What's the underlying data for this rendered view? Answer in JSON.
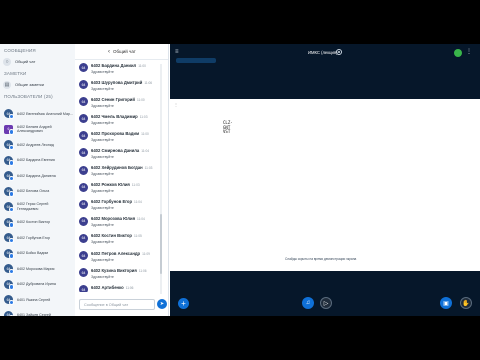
{
  "userlist": {
    "messages_title": "Сообщения",
    "public_chat": "Общий чат",
    "notes_title": "Заметки",
    "shared_notes": "Общие заметки",
    "users_title": "Пользователи (25)",
    "users": [
      {
        "initials": "64",
        "name": "6402 Евгенийчик Анатолий Мар..."
      },
      {
        "initials": "6",
        "name": "6402 Беляев Андрей\nАлександрович"
      },
      {
        "initials": "64",
        "name": "6402 Андреев Леонид"
      },
      {
        "initials": "64",
        "name": "6402 Бардина Евгения"
      },
      {
        "initials": "64",
        "name": "6402 Бардина Даниела"
      },
      {
        "initials": "64",
        "name": "6402 Белова Ольга"
      },
      {
        "initials": "64",
        "name": "6402 Герас Сергей\nГеннадьевич"
      },
      {
        "initials": "64",
        "name": "6402 Костин Виктор"
      },
      {
        "initials": "64",
        "name": "6402 Горбунов Егор"
      },
      {
        "initials": "64",
        "name": "6402 Бойко Вадим"
      },
      {
        "initials": "64",
        "name": "6402 Морозова Мария"
      },
      {
        "initials": "64",
        "name": "6402 Дубровина Ирина"
      },
      {
        "initials": "64",
        "name": "6401 Яшина Сергей"
      },
      {
        "initials": "64",
        "name": "6401 Зайцев Сергей"
      }
    ]
  },
  "chat": {
    "title": "Общий чат",
    "input_placeholder": "Сообщение в Общий чат",
    "messages": [
      {
        "initials": "64",
        "name": "6402 Бардина Даниил",
        "time": "11:00",
        "text": "Здравствуйте"
      },
      {
        "initials": "64",
        "name": "6403 Шурупова Дмитрий",
        "time": "11:06",
        "text": "Здравствуйте"
      },
      {
        "initials": "64",
        "name": "6402 Сенин Григорий",
        "time": "11:00",
        "text": "Здравствуйте"
      },
      {
        "initials": "64",
        "name": "6402 Чмель Владимир",
        "time": "11:03",
        "text": "Здравствуйте"
      },
      {
        "initials": "64",
        "name": "6402 Прохорова Вадим",
        "time": "11:00",
        "text": "Здравствуйте"
      },
      {
        "initials": "64",
        "name": "6402 Смирнова Данила",
        "time": "11:04",
        "text": "Здравствуйте"
      },
      {
        "initials": "64",
        "name": "6402 Хейрудинов Богдан",
        "time": "11:03",
        "text": "Здравствуйте"
      },
      {
        "initials": "64",
        "name": "6402 Рожков Юлия",
        "time": "11:03",
        "text": "Здравствуйте"
      },
      {
        "initials": "64",
        "name": "6402 Горбунов Егор",
        "time": "11:04",
        "text": "Здравствуйте"
      },
      {
        "initials": "64",
        "name": "6402 Морозова Юлия",
        "time": "11:04",
        "text": "Здравствуйте"
      },
      {
        "initials": "64",
        "name": "6402 Костин Виктор",
        "time": "11:05",
        "text": "Здравствуйте"
      },
      {
        "initials": "64",
        "name": "6402 Петров Александр",
        "time": "11:09",
        "text": "Здравствуйте"
      },
      {
        "initials": "64",
        "name": "6402 Кузина Виктория",
        "time": "11:06",
        "text": "Здравствуйте"
      },
      {
        "initials": "64",
        "name": "6402 Артибенко",
        "time": "11:06",
        "text": "Здравствуйте"
      }
    ]
  },
  "main": {
    "meeting_title": "ИМКС (лекция)",
    "slide_text": "CLZ-\nGNT\nVST",
    "slide_footer": "Слайды скрыты на время демонстрации экрана",
    "colors": {
      "accent": "#0f70d7",
      "background": "#06172a",
      "connection": "#39b54a"
    }
  }
}
